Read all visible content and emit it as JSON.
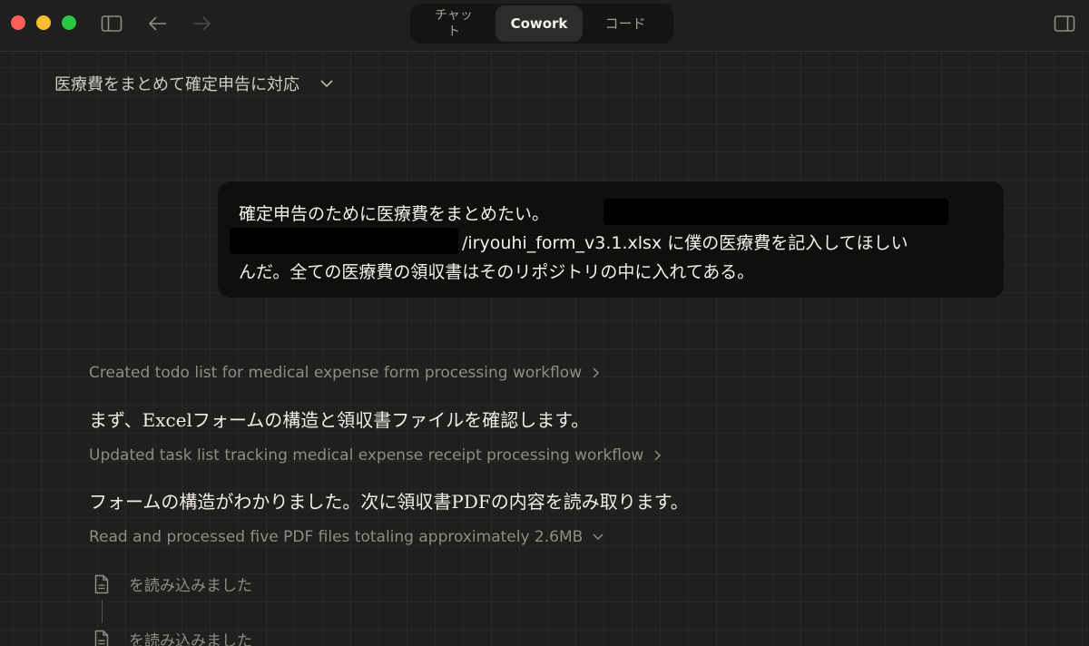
{
  "titlebar": {
    "tabs": [
      {
        "label": "チャット"
      },
      {
        "label": "Cowork"
      },
      {
        "label": "コード"
      }
    ],
    "icons": {
      "sidebar_toggle": "sidebar-icon",
      "back": "arrow-left-icon",
      "forward": "arrow-right-icon",
      "right_panel": "panel-icon"
    },
    "colors": {
      "close": "#fe5f57",
      "minimize": "#febc2e",
      "zoom": "#28c840"
    }
  },
  "conversation": {
    "title": "医療費をまとめて確定申告に対応"
  },
  "user_message": {
    "line1": "確定申告のために医療費をまとめたい。",
    "line2": "/iryouhi_form_v3.1.xlsx に僕の医療費を記入してほしい",
    "line3": "んだ。全ての医療費の領収書はそのリポジトリの中に入れてある。"
  },
  "assistant": {
    "step1": "Created todo list for medical expense form processing workflow",
    "reply1": "まず、Excelフォームの構造と領収書ファイルを確認します。",
    "step2": "Updated task list tracking medical expense receipt processing workflow",
    "reply2": "フォームの構造がわかりました。次に領収書PDFの内容を読み取ります。",
    "step3": "Read and processed five PDF files totaling approximately 2.6MB",
    "files": [
      {
        "label": "を読み込みました"
      },
      {
        "label": "を読み込みました"
      }
    ]
  }
}
